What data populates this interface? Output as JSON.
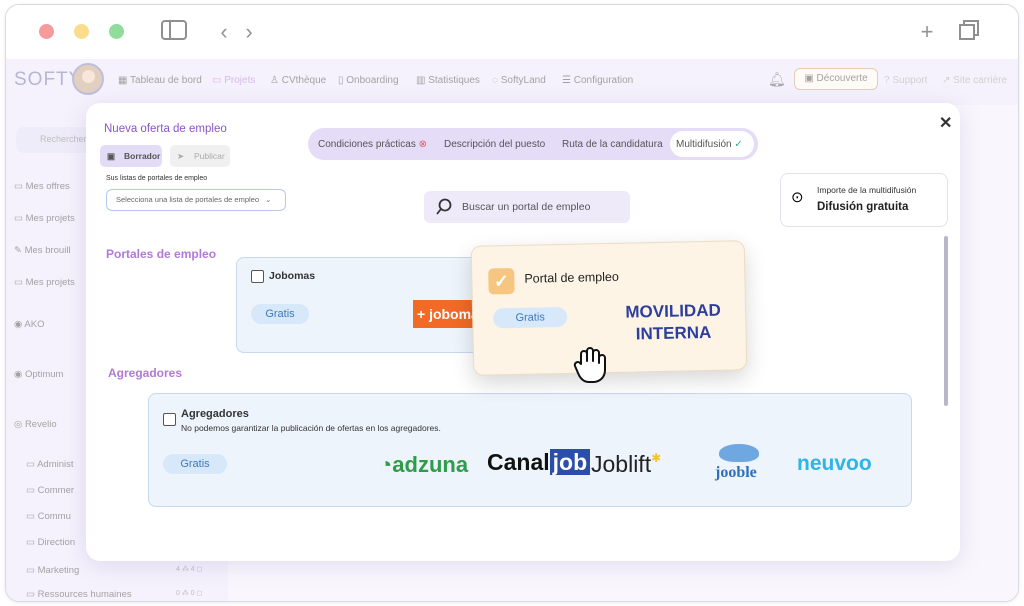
{
  "topnav": {
    "logo": "SOFTY",
    "items": [
      "Tableau de bord",
      "Projets",
      "CVthèque",
      "Onboarding",
      "Statistiques",
      "SoftyLand",
      "Configuration"
    ],
    "decouverte": "Découverte",
    "support": "Support",
    "site": "Site carrière"
  },
  "sidebar": {
    "search_placeholder": "Rechercher",
    "items": [
      "Mes offres",
      "Mes projets",
      "Mes brouill",
      "Mes projets",
      "AKO",
      "Optimum",
      "Revelio",
      "Administ",
      "Commer",
      "Commu",
      "Direction",
      "Marketing",
      "Ressources humaines"
    ],
    "counts": {
      "marketing": "4 ⁂ 4 ◻",
      "rh": "0 ⁂ 0 ◻"
    }
  },
  "modal": {
    "title": "Nueva oferta de empleo",
    "draft_label": "Borrador",
    "publish_label": "Publicar",
    "list_label": "Sus listas de portales de empleo",
    "select_placeholder": "Selecciona una lista de portales de empleo",
    "steps": [
      "Condiciones prácticas",
      "Descripción del puesto",
      "Ruta de la candidatura",
      "Multidifusión"
    ],
    "search_placeholder": "Buscar un portal de empleo",
    "import_title": "Importe de la multidifusión",
    "import_value": "Difusión gratuita",
    "section_portals": "Portales de empleo",
    "section_aggregators": "Agregadores",
    "jobomas": {
      "name": "Jobomas",
      "price": "Gratis",
      "logo_text": "+ jobomas"
    },
    "drag_card": {
      "name": "Portal de empleo",
      "price": "Gratis",
      "logo_text": "MOVILIDAD INTERNA"
    },
    "aggregators": {
      "name": "Agregadores",
      "note": "No podemos garantizar la publicación de ofertas en los agregadores.",
      "price": "Gratis",
      "logos": [
        "adzuna",
        "Canal",
        "job",
        "Joblift",
        "jooble",
        "neuvoo"
      ]
    }
  },
  "colors": {
    "accent": "#8a55c6",
    "lavender": "#ede8fb",
    "pill_blue": "#3d7ab8"
  }
}
